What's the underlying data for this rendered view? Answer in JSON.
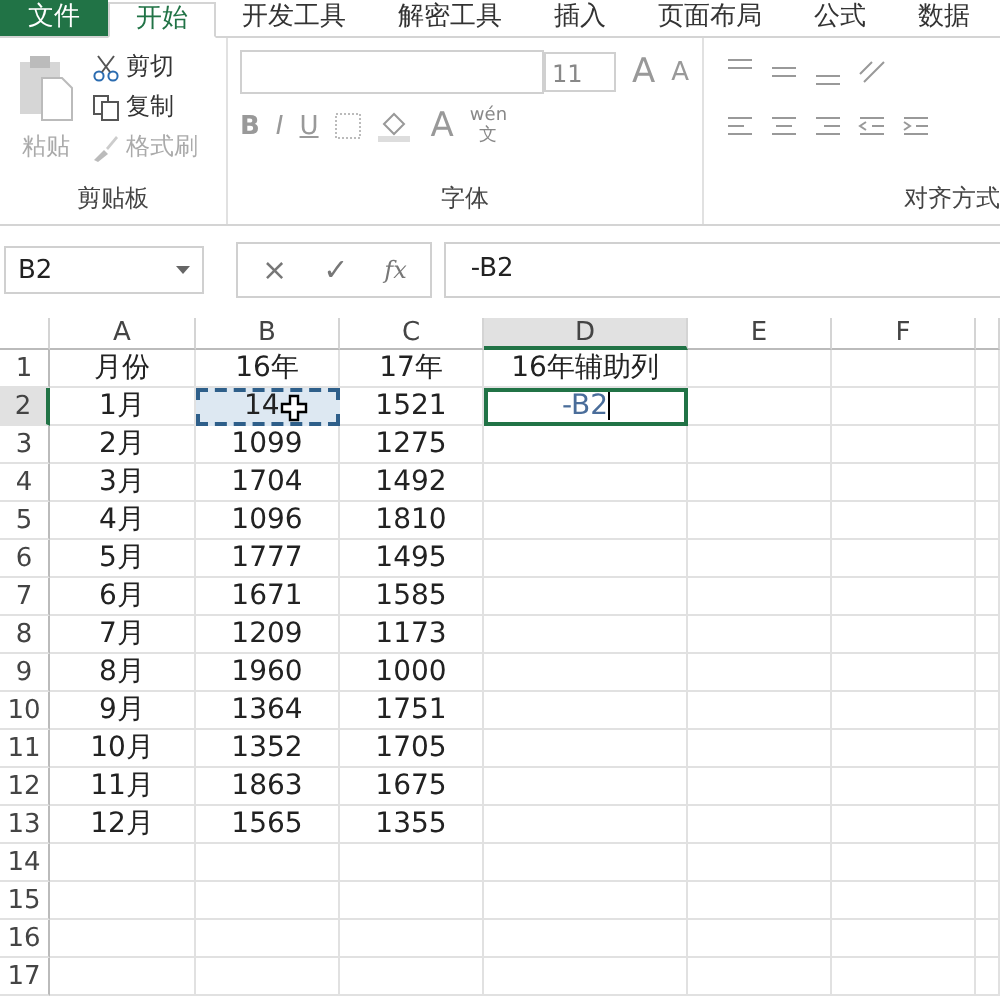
{
  "ribbon_tabs": [
    {
      "label": "文件",
      "kind": "file",
      "selected": false
    },
    {
      "label": "开始",
      "kind": "tab",
      "selected": true
    },
    {
      "label": "开发工具",
      "kind": "tab",
      "selected": false
    },
    {
      "label": "解密工具",
      "kind": "tab",
      "selected": false
    },
    {
      "label": "插入",
      "kind": "tab",
      "selected": false
    },
    {
      "label": "页面布局",
      "kind": "tab",
      "selected": false
    },
    {
      "label": "公式",
      "kind": "tab",
      "selected": false
    },
    {
      "label": "数据",
      "kind": "tab",
      "selected": false
    }
  ],
  "clipboard": {
    "paste": "粘贴",
    "cut": "剪切",
    "copy": "复制",
    "format_painter": "格式刷",
    "label": "剪贴板"
  },
  "font": {
    "size": "11",
    "grow": "A",
    "shrink": "A",
    "bold": "B",
    "italic": "I",
    "underline": "U",
    "font_color": "A",
    "phonetic_top": "wén",
    "phonetic_bottom": "文",
    "label": "字体"
  },
  "alignment": {
    "label": "对齐方式"
  },
  "formula_bar": {
    "name_box": "B2",
    "cancel": "×",
    "enter": "✓",
    "function": "fx",
    "formula": "-B2"
  },
  "columns": [
    {
      "label": "A",
      "selected": false
    },
    {
      "label": "B",
      "selected": false
    },
    {
      "label": "C",
      "selected": false
    },
    {
      "label": "D",
      "selected": true
    },
    {
      "label": "E",
      "selected": false
    },
    {
      "label": "F",
      "selected": false
    }
  ],
  "rows": [
    {
      "header": "1",
      "selected": false,
      "cells": [
        {
          "text": "月份",
          "marquee": false,
          "editing": false
        },
        {
          "text": "16年",
          "marquee": false,
          "editing": false
        },
        {
          "text": "17年",
          "marquee": false,
          "editing": false
        },
        {
          "text": "16年辅助列",
          "marquee": false,
          "editing": false
        }
      ]
    },
    {
      "header": "2",
      "selected": true,
      "cells": [
        {
          "text": "1月",
          "marquee": false,
          "editing": false
        },
        {
          "text": "14",
          "marquee": true,
          "editing": false
        },
        {
          "text": "1521",
          "marquee": false,
          "editing": false
        },
        {
          "text": "-B2",
          "marquee": false,
          "editing": true
        }
      ]
    },
    {
      "header": "3",
      "selected": false,
      "cells": [
        {
          "text": "2月",
          "marquee": false,
          "editing": false
        },
        {
          "text": "1099",
          "marquee": false,
          "editing": false
        },
        {
          "text": "1275",
          "marquee": false,
          "editing": false
        }
      ]
    },
    {
      "header": "4",
      "selected": false,
      "cells": [
        {
          "text": "3月",
          "marquee": false,
          "editing": false
        },
        {
          "text": "1704",
          "marquee": false,
          "editing": false
        },
        {
          "text": "1492",
          "marquee": false,
          "editing": false
        }
      ]
    },
    {
      "header": "5",
      "selected": false,
      "cells": [
        {
          "text": "4月",
          "marquee": false,
          "editing": false
        },
        {
          "text": "1096",
          "marquee": false,
          "editing": false
        },
        {
          "text": "1810",
          "marquee": false,
          "editing": false
        }
      ]
    },
    {
      "header": "6",
      "selected": false,
      "cells": [
        {
          "text": "5月",
          "marquee": false,
          "editing": false
        },
        {
          "text": "1777",
          "marquee": false,
          "editing": false
        },
        {
          "text": "1495",
          "marquee": false,
          "editing": false
        }
      ]
    },
    {
      "header": "7",
      "selected": false,
      "cells": [
        {
          "text": "6月",
          "marquee": false,
          "editing": false
        },
        {
          "text": "1671",
          "marquee": false,
          "editing": false
        },
        {
          "text": "1585",
          "marquee": false,
          "editing": false
        }
      ]
    },
    {
      "header": "8",
      "selected": false,
      "cells": [
        {
          "text": "7月",
          "marquee": false,
          "editing": false
        },
        {
          "text": "1209",
          "marquee": false,
          "editing": false
        },
        {
          "text": "1173",
          "marquee": false,
          "editing": false
        }
      ]
    },
    {
      "header": "9",
      "selected": false,
      "cells": [
        {
          "text": "8月",
          "marquee": false,
          "editing": false
        },
        {
          "text": "1960",
          "marquee": false,
          "editing": false
        },
        {
          "text": "1000",
          "marquee": false,
          "editing": false
        }
      ]
    },
    {
      "header": "10",
      "selected": false,
      "cells": [
        {
          "text": "9月",
          "marquee": false,
          "editing": false
        },
        {
          "text": "1364",
          "marquee": false,
          "editing": false
        },
        {
          "text": "1751",
          "marquee": false,
          "editing": false
        }
      ]
    },
    {
      "header": "11",
      "selected": false,
      "cells": [
        {
          "text": "10月",
          "marquee": false,
          "editing": false
        },
        {
          "text": "1352",
          "marquee": false,
          "editing": false
        },
        {
          "text": "1705",
          "marquee": false,
          "editing": false
        }
      ]
    },
    {
      "header": "12",
      "selected": false,
      "cells": [
        {
          "text": "11月",
          "marquee": false,
          "editing": false
        },
        {
          "text": "1863",
          "marquee": false,
          "editing": false
        },
        {
          "text": "1675",
          "marquee": false,
          "editing": false
        }
      ]
    },
    {
      "header": "13",
      "selected": false,
      "cells": [
        {
          "text": "12月",
          "marquee": false,
          "editing": false
        },
        {
          "text": "1565",
          "marquee": false,
          "editing": false
        },
        {
          "text": "1355",
          "marquee": false,
          "editing": false
        }
      ]
    },
    {
      "header": "14",
      "selected": false,
      "cells": []
    },
    {
      "header": "15",
      "selected": false,
      "cells": []
    },
    {
      "header": "16",
      "selected": false,
      "cells": []
    },
    {
      "header": "17",
      "selected": false,
      "cells": []
    }
  ]
}
